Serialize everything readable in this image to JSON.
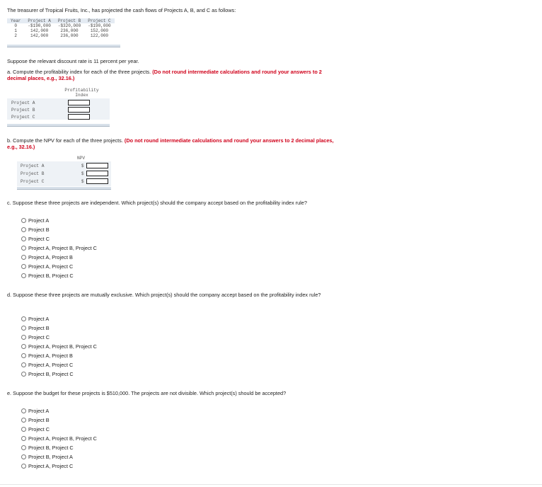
{
  "intro": "The treasurer of Tropical Fruits, Inc., has projected the cash flows of Projects A, B, and C as follows:",
  "cashflow": {
    "headers": [
      "Year",
      "Project A",
      "Project B",
      "Project C"
    ],
    "rows": [
      [
        "0",
        "-$190,000",
        "-$320,000",
        "-$190,000"
      ],
      [
        "1",
        "142,000",
        "236,000",
        "152,000"
      ],
      [
        "2",
        "142,000",
        "236,000",
        "122,000"
      ]
    ]
  },
  "discount_text": "Suppose the relevant discount rate is 11 percent per year.",
  "part_a": {
    "question": "a. Compute the profitability index for each of the three projects.",
    "instruction": "(Do not round intermediate calculations and round your answers to 2 decimal places, e.g., 32.16.)",
    "header_line1": "Profitability",
    "header_line2": "Index",
    "rows": [
      "Project A",
      "Project B",
      "Project C"
    ],
    "values": [
      "",
      "",
      ""
    ]
  },
  "part_b": {
    "question": "b. Compute the NPV for each of the three projects.",
    "instruction": "(Do not round intermediate calculations and round your answers to 2 decimal places, e.g., 32.16.)",
    "header": "NPV",
    "currency": "$",
    "rows": [
      "Project A",
      "Project B",
      "Project C"
    ],
    "values": [
      "",
      "",
      ""
    ]
  },
  "part_c": {
    "question": "c. Suppose these three projects are independent. Which project(s) should the company accept based on the profitability index rule?",
    "options": [
      "Project A",
      "Project B",
      "Project C",
      "Project A, Project B, Project C",
      "Project A, Project B",
      "Project A, Project C",
      "Project B, Project C"
    ]
  },
  "part_d": {
    "question": "d. Suppose these three projects are mutually exclusive. Which project(s) should the company accept based on the profitability index rule?",
    "options": [
      "Project A",
      "Project B",
      "Project C",
      "Project A, Project B, Project C",
      "Project A, Project B",
      "Project A, Project C",
      "Project B, Project C"
    ]
  },
  "part_e": {
    "question": "e. Suppose the budget for these projects is $510,000. The projects are not divisible. Which project(s) should be accepted?",
    "options": [
      "Project A",
      "Project B",
      "Project C",
      "Project A, Project B, Project C",
      "Project B, Project C",
      "Project B, Project A",
      "Project A, Project C"
    ]
  }
}
